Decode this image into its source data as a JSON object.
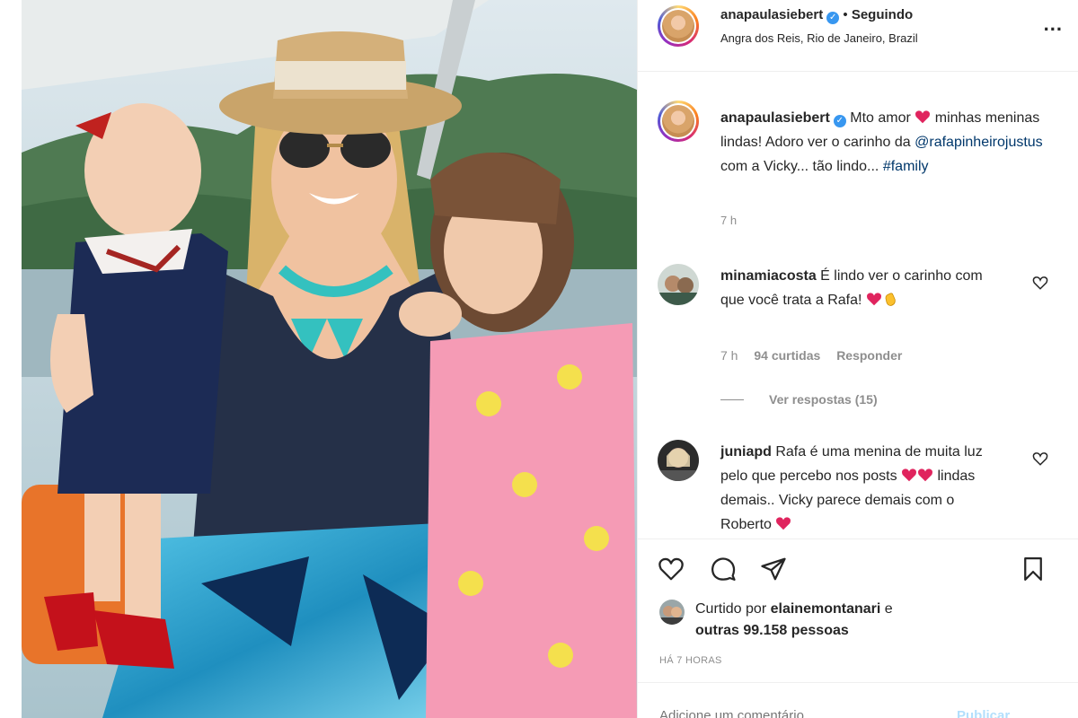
{
  "post": {
    "author": "anapaulasiebert",
    "follow_state": "Seguindo",
    "separator": "•",
    "location": "Angra dos Reis, Rio de Janeiro, Brazil",
    "more_label": "..."
  },
  "caption": {
    "username": "anapaulasiebert",
    "text_1": "Mto amor",
    "text_2": "minhas meninas lindas! Adoro ver o carinho da",
    "mention": "@rafapinheirojustus",
    "text_3": "com a Vicky... tão lindo...",
    "hashtag": "#family",
    "time": "7 h"
  },
  "comments": [
    {
      "username": "minamiacosta",
      "text": "É lindo ver o carinho com que você trata a Rafa!",
      "time": "7 h",
      "likes": "94 curtidas",
      "reply": "Responder",
      "view_replies": "Ver respostas (15)"
    },
    {
      "username": "juniapd",
      "text_1": "Rafa é uma menina de muita luz pelo que percebo nos posts",
      "text_2": "lindas demais.. Vicky parece demais com o Roberto"
    }
  ],
  "likes": {
    "prefix": "Curtido por",
    "liker": "elainemontanari",
    "and": "e",
    "others": "outras 99.158 pessoas"
  },
  "timestamp": "HÁ 7 HORAS",
  "comment_input": {
    "placeholder": "Adicione um comentário...",
    "publish": "Publicar"
  },
  "colors": {
    "accent_link": "#00376b",
    "verified": "#3897f0",
    "heart": "#e0245e",
    "muted": "#8e8e8e"
  }
}
